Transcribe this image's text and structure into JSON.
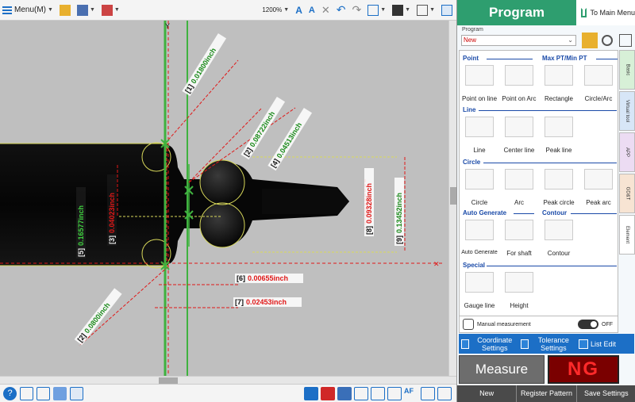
{
  "toolbar": {
    "menu_label": "Menu(M)",
    "zoom_label": "1200%"
  },
  "canvas": {
    "axis_label_y": "Y",
    "measurements": [
      {
        "id": "[1]",
        "value": "0.01800inch"
      },
      {
        "id": "[2]",
        "value": "0.08722inch"
      },
      {
        "id": "[4]",
        "value": "0.04513inch"
      },
      {
        "id": "[5]",
        "value": "0.16577inch"
      },
      {
        "id": "[3]",
        "value": "0.04023inch"
      },
      {
        "id": "[8]",
        "value": "0.09328inch"
      },
      {
        "id": "[9]",
        "value": "0.13452inch"
      },
      {
        "id": "[6]",
        "value": "0.00655inch"
      },
      {
        "id": "[7]",
        "value": "0.02453inch"
      },
      {
        "id": "[2]",
        "value": "0.0800inch"
      }
    ]
  },
  "panel": {
    "title": "Program",
    "main_menu": "To Main Menu",
    "program_label": "Program",
    "program_value": "New",
    "sections": {
      "point": "Point",
      "maxpt": "Max PT/Min PT",
      "line": "Line",
      "circle": "Circle",
      "auto": "Auto Generate",
      "contour": "Contour",
      "special": "Special"
    },
    "tools": {
      "point_on_line": "Point on line",
      "point_on_arc": "Point on Arc",
      "rectangle": "Rectangle",
      "circle_arc": "Circle/Arc",
      "line": "Line",
      "center_line": "Center line",
      "peak_line": "Peak line",
      "circle": "Circle",
      "arc": "Arc",
      "peak_circle": "Peak circle",
      "peak_arc": "Peak arc",
      "auto_generate": "Auto Generate",
      "for_shaft": "For shaft",
      "contour": "Contour",
      "gauge_line": "Gauge line",
      "height": "Height"
    },
    "vtabs": [
      "Basic",
      "Virtual tool",
      "APP",
      "GD&T",
      "Element"
    ],
    "manual_label": "Manual measurement",
    "manual_state": "OFF",
    "settings": {
      "coordinate": "Coordinate Settings",
      "tolerance": "Tolerance Settings",
      "list_edit": "List Edit"
    },
    "measure_label": "Measure",
    "result": "NG",
    "bottom": {
      "new": "New",
      "register": "Register Pattern",
      "save": "Save Settings"
    }
  },
  "colors": {
    "panel_header": "#2e9e6f",
    "settings_bar": "#1c6fc6",
    "ng_text": "#ff2a2a",
    "ng_bg": "#7a0000",
    "dimension_red": "#e01818",
    "edge_green": "#3fb23f"
  }
}
